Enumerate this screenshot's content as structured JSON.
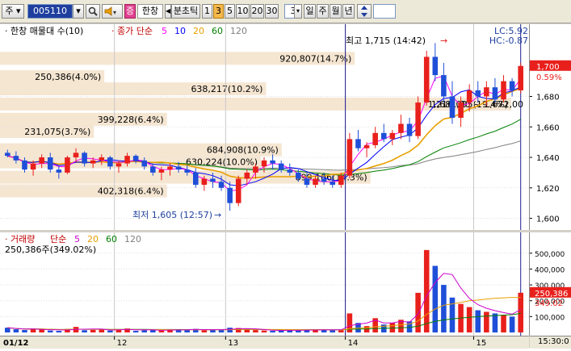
{
  "toolbar": {
    "market_select": "주",
    "stock_code": "005110",
    "alert_icon": "speaker-icon",
    "company_badge": "증",
    "company_name": "한창",
    "period_label": "분초틱",
    "interval_buttons": [
      "1",
      "3",
      "5",
      "10",
      "20",
      "30"
    ],
    "interval_selected": "3",
    "interval_input": "3",
    "period_tabs": [
      "일",
      "주",
      "월",
      "년"
    ],
    "updown_icon": "up-down-arrow-icon"
  },
  "price_pane": {
    "title": "한창 매물대 수(10)",
    "ma_label": "종가 단순",
    "ma_periods": [
      "5",
      "10",
      "20",
      "60",
      "120"
    ],
    "colors": {
      "ma5": "#ff00ff",
      "ma10": "#0000ff",
      "ma20": "#e8a000",
      "ma60": "#008000",
      "ma120": "#808080"
    },
    "high_label": "최고 1,715 (14:42)",
    "low_label": "최저 1,605 (12:57)",
    "lc": "LC:5.92",
    "hc": "HC:-0.87",
    "volume_profile": [
      {
        "label": "920,807(14.7%)",
        "price": 1705,
        "length": 0.68
      },
      {
        "label": "250,386(4.0%)",
        "price": 1693,
        "length": 0.2
      },
      {
        "label": "638,217(10.2%)",
        "price": 1685,
        "length": 0.51
      },
      {
        "label": "1,216,095(19.4%)",
        "price": 1675,
        "length": 0.98
      },
      {
        "label": "399,228(6.4%)",
        "price": 1665,
        "length": 0.32
      },
      {
        "label": "231,075(3.7%)",
        "price": 1657,
        "length": 0.18
      },
      {
        "label": "684,908(10.9%)",
        "price": 1645,
        "length": 0.54
      },
      {
        "label": "630,224(10.0%)",
        "price": 1637,
        "length": 0.5
      },
      {
        "label": "899,106(14.3%)",
        "price": 1627,
        "length": 0.71
      },
      {
        "label": "402,318(6.4%)",
        "price": 1618,
        "length": 0.32
      }
    ],
    "right_overlay": "1,681,00 ~ 1,672,00"
  },
  "price_axis": {
    "ticks": [
      "1,680",
      "1,660",
      "1,640",
      "1,620",
      "1,600"
    ],
    "current_price": "1,700",
    "current_change": "0.59%"
  },
  "vol_pane": {
    "title": "거래량",
    "ma_label": "단순",
    "ma_periods": [
      "5",
      "20",
      "60",
      "120"
    ],
    "current_volume": "250,386주(349.02%)",
    "colors": {
      "up": "#e8201c",
      "down": "#1f4fd8",
      "ma5": "#cc00cc",
      "ma20": "#e8a000",
      "ma60": "#008000",
      "ma120": "#808080"
    }
  },
  "vol_axis": {
    "ticks": [
      "500,000",
      "400,000",
      "300,000",
      "200,000",
      "100,000"
    ],
    "current_volume": "250,386",
    "current_ratio": "349.02"
  },
  "x_axis": {
    "labels": [
      "01/12",
      "12",
      "13",
      "14",
      "15"
    ],
    "time": "15:30:0"
  },
  "chart_data": {
    "type": "candlestick",
    "y_range": [
      1595,
      1720
    ],
    "volume_range": [
      0,
      560000
    ],
    "day_labels": [
      "01/12",
      "12",
      "13",
      "14",
      "15"
    ],
    "candles": [
      [
        1643,
        1645,
        1640,
        1641
      ],
      [
        1641,
        1644,
        1636,
        1638
      ],
      [
        1638,
        1640,
        1630,
        1632
      ],
      [
        1632,
        1638,
        1628,
        1636
      ],
      [
        1636,
        1642,
        1633,
        1640
      ],
      [
        1640,
        1643,
        1630,
        1632
      ],
      [
        1632,
        1635,
        1626,
        1630
      ],
      [
        1630,
        1641,
        1629,
        1640
      ],
      [
        1640,
        1646,
        1637,
        1643
      ],
      [
        1643,
        1644,
        1634,
        1636
      ],
      [
        1636,
        1640,
        1633,
        1638
      ],
      [
        1638,
        1642,
        1635,
        1640
      ],
      [
        1640,
        1641,
        1632,
        1634
      ],
      [
        1634,
        1638,
        1630,
        1636
      ],
      [
        1636,
        1643,
        1634,
        1641
      ],
      [
        1641,
        1642,
        1636,
        1638
      ],
      [
        1638,
        1640,
        1632,
        1634
      ],
      [
        1634,
        1636,
        1628,
        1630
      ],
      [
        1630,
        1634,
        1625,
        1632
      ],
      [
        1632,
        1636,
        1628,
        1634
      ],
      [
        1634,
        1637,
        1630,
        1632
      ],
      [
        1632,
        1635,
        1628,
        1630
      ],
      [
        1630,
        1633,
        1620,
        1622
      ],
      [
        1622,
        1628,
        1618,
        1626
      ],
      [
        1626,
        1630,
        1620,
        1624
      ],
      [
        1624,
        1628,
        1618,
        1620
      ],
      [
        1620,
        1624,
        1605,
        1610
      ],
      [
        1610,
        1628,
        1608,
        1626
      ],
      [
        1626,
        1632,
        1622,
        1630
      ],
      [
        1630,
        1636,
        1626,
        1634
      ],
      [
        1634,
        1640,
        1630,
        1638
      ],
      [
        1638,
        1642,
        1632,
        1636
      ],
      [
        1636,
        1638,
        1630,
        1632
      ],
      [
        1632,
        1636,
        1628,
        1630
      ],
      [
        1630,
        1632,
        1624,
        1626
      ],
      [
        1626,
        1630,
        1620,
        1622
      ],
      [
        1622,
        1628,
        1620,
        1626
      ],
      [
        1626,
        1630,
        1622,
        1624
      ],
      [
        1624,
        1628,
        1620,
        1622
      ],
      [
        1622,
        1630,
        1620,
        1628
      ],
      [
        1628,
        1656,
        1626,
        1652
      ],
      [
        1652,
        1658,
        1644,
        1646
      ],
      [
        1646,
        1650,
        1640,
        1648
      ],
      [
        1648,
        1660,
        1646,
        1656
      ],
      [
        1656,
        1662,
        1650,
        1652
      ],
      [
        1652,
        1658,
        1648,
        1656
      ],
      [
        1656,
        1668,
        1652,
        1662
      ],
      [
        1662,
        1666,
        1650,
        1654
      ],
      [
        1654,
        1680,
        1652,
        1676
      ],
      [
        1676,
        1710,
        1674,
        1706
      ],
      [
        1706,
        1715,
        1690,
        1694
      ],
      [
        1694,
        1702,
        1676,
        1680
      ],
      [
        1680,
        1690,
        1662,
        1666
      ],
      [
        1666,
        1680,
        1660,
        1676
      ],
      [
        1676,
        1688,
        1670,
        1684
      ],
      [
        1684,
        1690,
        1676,
        1680
      ],
      [
        1680,
        1690,
        1674,
        1686
      ],
      [
        1686,
        1692,
        1676,
        1678
      ],
      [
        1678,
        1694,
        1676,
        1690
      ],
      [
        1690,
        1692,
        1680,
        1684
      ],
      [
        1684,
        1702,
        1682,
        1700
      ]
    ],
    "volumes": [
      30000,
      20000,
      15000,
      25000,
      18000,
      12000,
      10000,
      22000,
      35000,
      14000,
      16000,
      20000,
      12000,
      18000,
      25000,
      10000,
      14000,
      16000,
      12000,
      20000,
      15000,
      18000,
      22000,
      14000,
      16000,
      20000,
      30000,
      28000,
      18000,
      15000,
      12000,
      10000,
      14000,
      16000,
      12000,
      18000,
      15000,
      20000,
      14000,
      16000,
      120000,
      60000,
      40000,
      90000,
      50000,
      60000,
      80000,
      70000,
      250000,
      520000,
      420000,
      300000,
      220000,
      180000,
      160000,
      140000,
      130000,
      120000,
      110000,
      100000,
      250386
    ]
  }
}
